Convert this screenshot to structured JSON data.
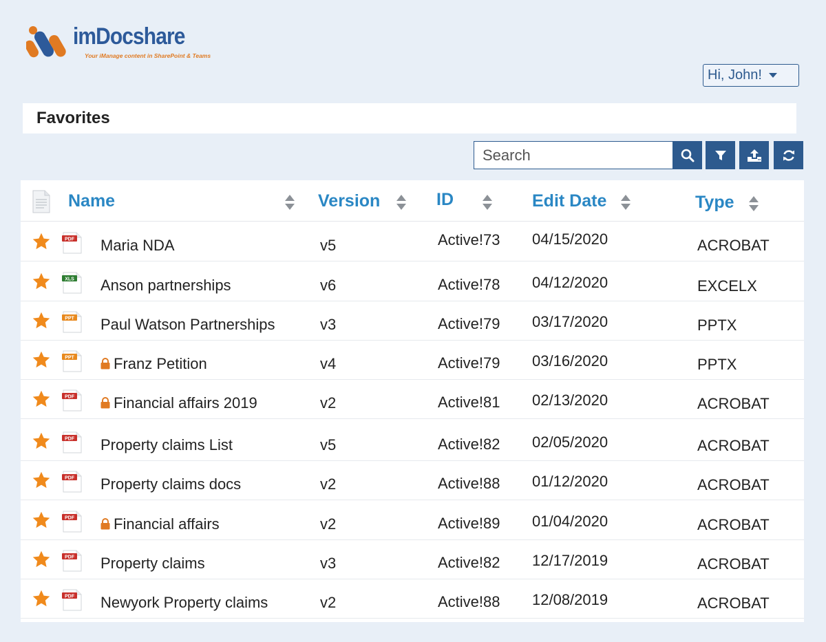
{
  "brand": {
    "name_prefix": "im",
    "name_main": "Docshare",
    "tagline": "Your iManage content in SharePoint & Teams",
    "primary_color": "#2d5a9a",
    "accent_color": "#e07a22"
  },
  "user_menu": {
    "label": "Hi, John!"
  },
  "page": {
    "title": "Favorites"
  },
  "toolbar": {
    "search_placeholder": "Search",
    "buttons": [
      "search-icon",
      "filter-icon",
      "upload-icon",
      "refresh-icon"
    ]
  },
  "table": {
    "columns": {
      "name": "Name",
      "version": "Version",
      "id": "ID",
      "edit_date": "Edit Date",
      "type": "Type"
    },
    "rows": [
      {
        "favorite": true,
        "icon": "PDF",
        "locked": false,
        "name": "Maria NDA",
        "version": "v5",
        "id": "Active!73",
        "edit_date": "04/15/2020",
        "type": "ACROBAT"
      },
      {
        "favorite": true,
        "icon": "XLS",
        "locked": false,
        "name": "Anson partnerships",
        "version": "v6",
        "id": "Active!78",
        "edit_date": "04/12/2020",
        "type": "EXCELX"
      },
      {
        "favorite": true,
        "icon": "PPT",
        "locked": false,
        "name": "Paul Watson Partnerships",
        "version": "v3",
        "id": "Active!79",
        "edit_date": "03/17/2020",
        "type": "PPTX"
      },
      {
        "favorite": true,
        "icon": "PPT",
        "locked": true,
        "name": "Franz Petition",
        "version": "v4",
        "id": "Active!79",
        "edit_date": "03/16/2020",
        "type": "PPTX"
      },
      {
        "favorite": true,
        "icon": "PDF",
        "locked": true,
        "name": "Financial affairs  2019",
        "version": "v2",
        "id": "Active!81",
        "edit_date": "02/13/2020",
        "type": "ACROBAT"
      },
      {
        "favorite": true,
        "icon": "PDF",
        "locked": false,
        "name": "Property claims List",
        "version": "v5",
        "id": "Active!82",
        "edit_date": "02/05/2020",
        "type": "ACROBAT"
      },
      {
        "favorite": true,
        "icon": "PDF",
        "locked": false,
        "name": "Property claims docs",
        "version": "v2",
        "id": "Active!88",
        "edit_date": "01/12/2020",
        "type": "ACROBAT"
      },
      {
        "favorite": true,
        "icon": "PDF",
        "locked": true,
        "name": "Financial affairs",
        "version": "v2",
        "id": "Active!89",
        "edit_date": "01/04/2020",
        "type": "ACROBAT"
      },
      {
        "favorite": true,
        "icon": "PDF",
        "locked": false,
        "name": "Property claims",
        "version": "v3",
        "id": "Active!82",
        "edit_date": "12/17/2019",
        "type": "ACROBAT"
      },
      {
        "favorite": true,
        "icon": "PDF",
        "locked": false,
        "name": "Newyork Property claims",
        "version": "v2",
        "id": "Active!88",
        "edit_date": "12/08/2019",
        "type": "ACROBAT"
      }
    ]
  },
  "colors": {
    "page_bg": "#e8eff7",
    "button_bg": "#2d5a8e",
    "header_text": "#2a87c4",
    "star": "#f08a1c",
    "lock": "#e07a22",
    "pdf_badge": "#c8302b",
    "xls_badge": "#2e7d32",
    "ppt_badge": "#e8891e"
  }
}
